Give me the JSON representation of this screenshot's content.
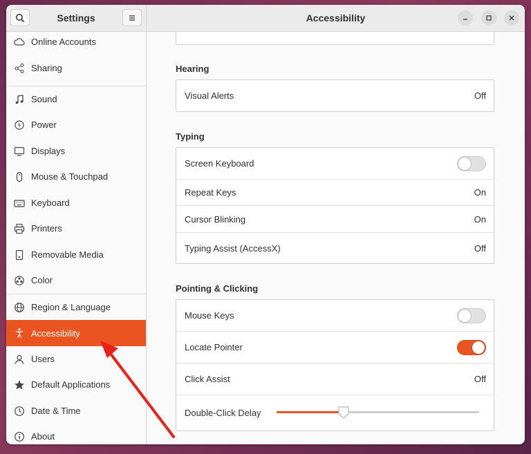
{
  "app": {
    "title": "Settings"
  },
  "page": {
    "title": "Accessibility"
  },
  "sidebar": {
    "items": [
      {
        "label": "Online Accounts",
        "icon": "cloud-icon"
      },
      {
        "label": "Sharing",
        "icon": "share-icon"
      },
      {
        "label": "Sound",
        "icon": "music-note-icon"
      },
      {
        "label": "Power",
        "icon": "power-icon"
      },
      {
        "label": "Displays",
        "icon": "display-icon"
      },
      {
        "label": "Mouse & Touchpad",
        "icon": "mouse-icon"
      },
      {
        "label": "Keyboard",
        "icon": "keyboard-icon"
      },
      {
        "label": "Printers",
        "icon": "printer-icon"
      },
      {
        "label": "Removable Media",
        "icon": "drive-icon"
      },
      {
        "label": "Color",
        "icon": "color-icon"
      },
      {
        "label": "Region & Language",
        "icon": "globe-icon"
      },
      {
        "label": "Accessibility",
        "icon": "accessibility-icon",
        "selected": true
      },
      {
        "label": "Users",
        "icon": "users-icon"
      },
      {
        "label": "Default Applications",
        "icon": "star-icon"
      },
      {
        "label": "Date & Time",
        "icon": "clock-icon"
      },
      {
        "label": "About",
        "icon": "info-icon"
      }
    ]
  },
  "hearing": {
    "title": "Hearing",
    "visual_alerts": {
      "label": "Visual Alerts",
      "value": "Off"
    }
  },
  "typing": {
    "title": "Typing",
    "screen_keyboard": {
      "label": "Screen Keyboard",
      "enabled": false
    },
    "repeat_keys": {
      "label": "Repeat Keys",
      "value": "On"
    },
    "cursor_blinking": {
      "label": "Cursor Blinking",
      "value": "On"
    },
    "typing_assist": {
      "label": "Typing Assist (AccessX)",
      "value": "Off"
    }
  },
  "pointing": {
    "title": "Pointing & Clicking",
    "mouse_keys": {
      "label": "Mouse Keys",
      "enabled": false
    },
    "locate_pointer": {
      "label": "Locate Pointer",
      "enabled": true
    },
    "click_assist": {
      "label": "Click Assist",
      "value": "Off"
    },
    "double_click_delay": {
      "label": "Double-Click Delay",
      "fraction": 0.33
    }
  },
  "colors": {
    "accent": "#e95420",
    "annotation_arrow": "#e8221b"
  }
}
